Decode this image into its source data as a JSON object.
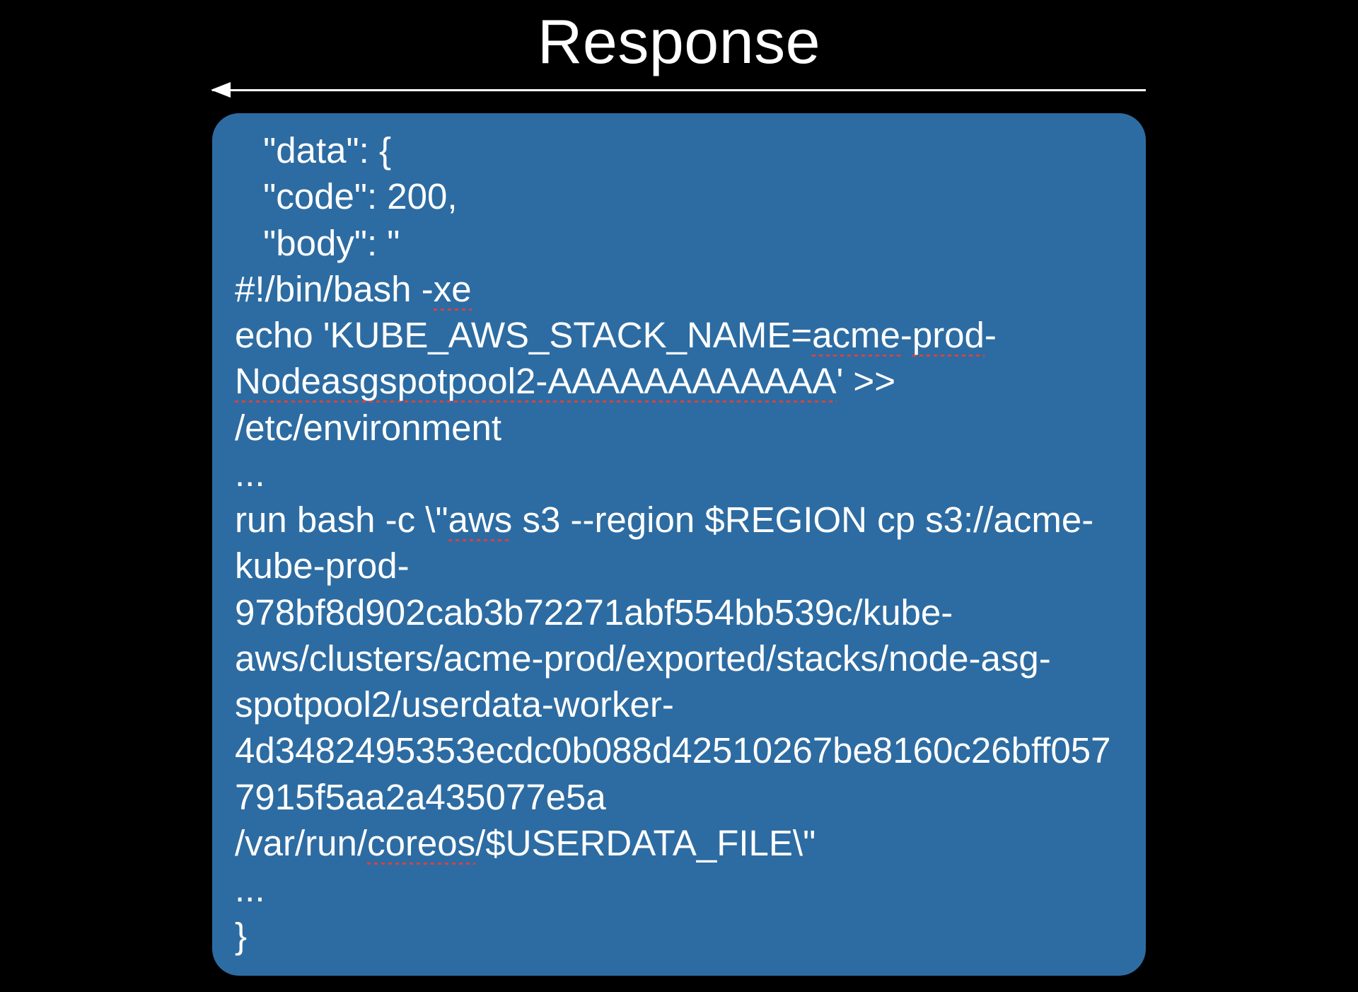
{
  "title": "Response",
  "code": {
    "line1": " \"data\": {",
    "line2": " \"code\": 200,",
    "line3": " \"body\": \"",
    "line4_pre": "#!/bin/bash -",
    "line4_sq": "xe",
    "line5_a": "echo 'KUBE_AWS_STACK_NAME=",
    "line5_sq1": "acme",
    "line5_b": "-",
    "line5_sq2": "prod",
    "line5_c": "-",
    "line6_sq": "Nodeasgspotpool2-AAAAAAAAAAAA",
    "line6_b": "' >> /etc/environment",
    "line7": "...",
    "line8_a": "run bash -c \\\"",
    "line8_sq": "aws",
    "line8_b": " s3 --region $REGION cp s3://acme-kube-prod-978bf8d902cab3b72271abf554bb539c/kube-aws/clusters/acme-prod/exported/stacks/node-asg-spotpool2/userdata-worker-4d3482495353ecdc0b088d42510267be8160c26bff0577915f5aa2a435077e5a /var/run/",
    "line8_sq2": "coreos",
    "line8_c": "/$USERDATA_FILE\\\"",
    "line9": "...",
    "line10": "}"
  }
}
